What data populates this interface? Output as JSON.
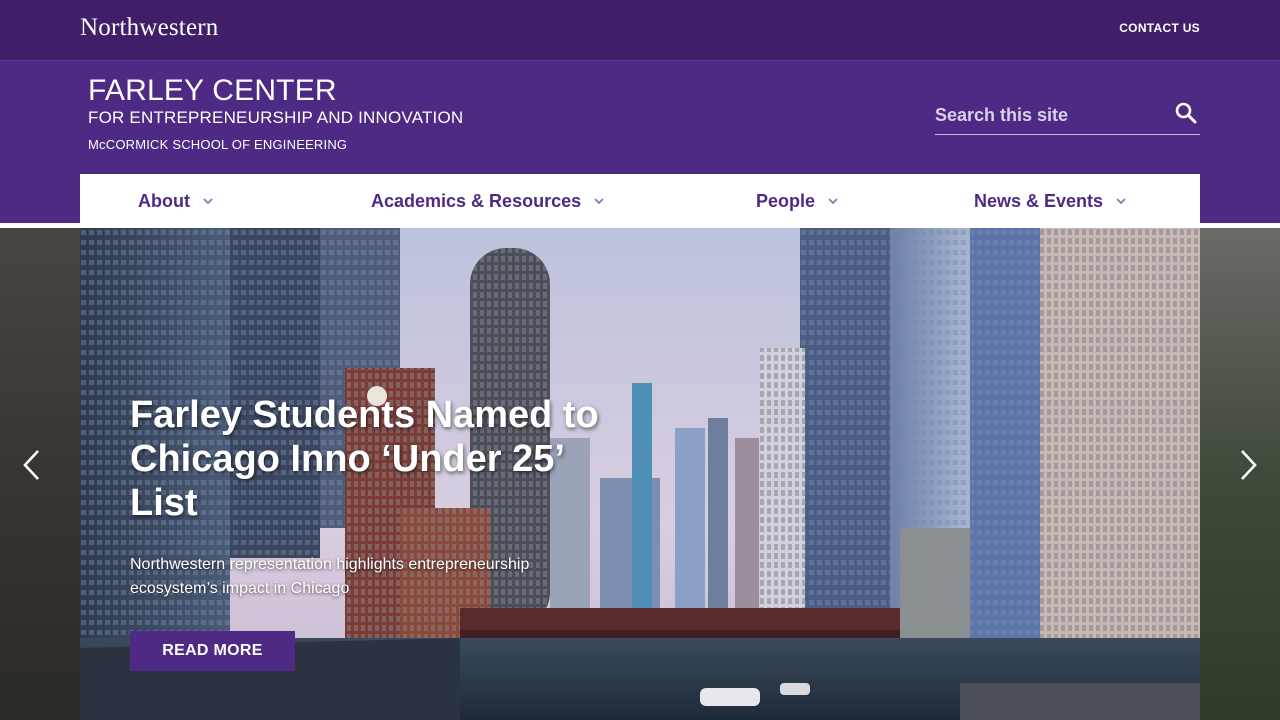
{
  "topbar": {
    "logo_text": "Northwestern",
    "contact_label": "CONTACT US"
  },
  "header": {
    "title": "FARLEY CENTER",
    "subtitle": "FOR ENTREPRENEURSHIP AND INNOVATION",
    "school": "McCORMICK SCHOOL OF ENGINEERING",
    "search_placeholder": "Search this site",
    "search_icon": "search-icon"
  },
  "nav": {
    "items": [
      {
        "label": "About"
      },
      {
        "label": "Academics & Resources"
      },
      {
        "label": "People"
      },
      {
        "label": "News & Events"
      }
    ]
  },
  "hero": {
    "title": "Farley Students Named to Chicago Inno ‘Under 25’ List",
    "description": "Northwestern representation highlights entrepreneurship ecosystem’s impact in Chicago",
    "cta_label": "READ MORE",
    "prev_icon": "chevron-left-icon",
    "next_icon": "chevron-right-icon"
  },
  "colors": {
    "brand_purple": "#4e2a84",
    "topbar_purple": "#401f68",
    "white": "#ffffff"
  }
}
